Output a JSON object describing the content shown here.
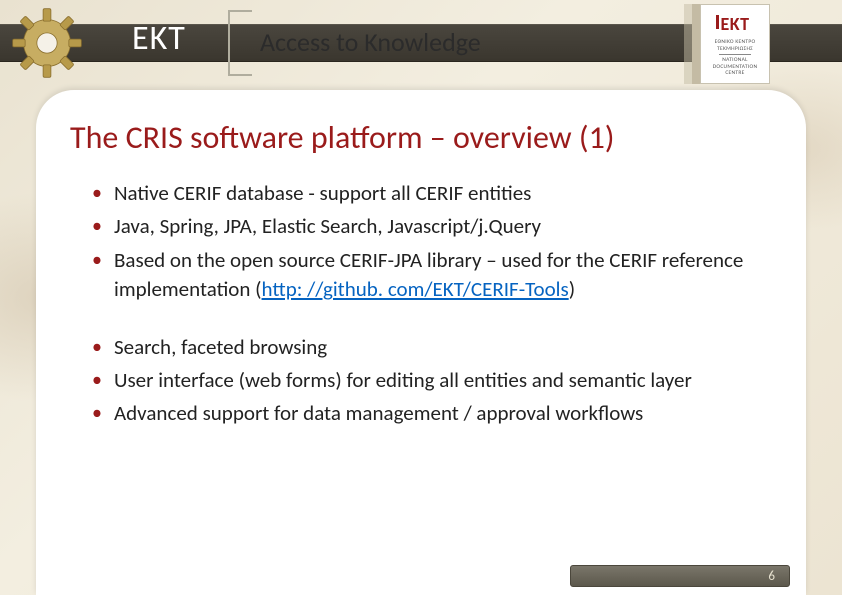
{
  "header": {
    "org": "EKT",
    "tagline": "Access to Knowledge",
    "logo": {
      "main": "EKT",
      "line1": "ΕΘΝΙΚΟ ΚΕΝΤΡΟ",
      "line2": "ΤΕΚΜΗΡΙΩΣΗΣ",
      "line3": "NATIONAL",
      "line4": "DOCUMENTATION",
      "line5": "CENTRE"
    }
  },
  "slide": {
    "title": "The CRIS software platform – overview (1)",
    "group1": [
      "Native CERIF database - support all CERIF entities",
      "Java, Spring, JPA, Elastic Search, Javascript/j.Query",
      "Based on the open source CERIF-JPA library – used for the CERIF reference implementation "
    ],
    "link_prefix": "(",
    "link_text": "http: //github. com/EKT/CERIF-Tools",
    "link_suffix": ")",
    "group2": [
      "Search, faceted browsing",
      "User interface (web forms) for editing all entities and semantic layer",
      "Advanced support for data management / approval workflows"
    ]
  },
  "page_number": "6"
}
